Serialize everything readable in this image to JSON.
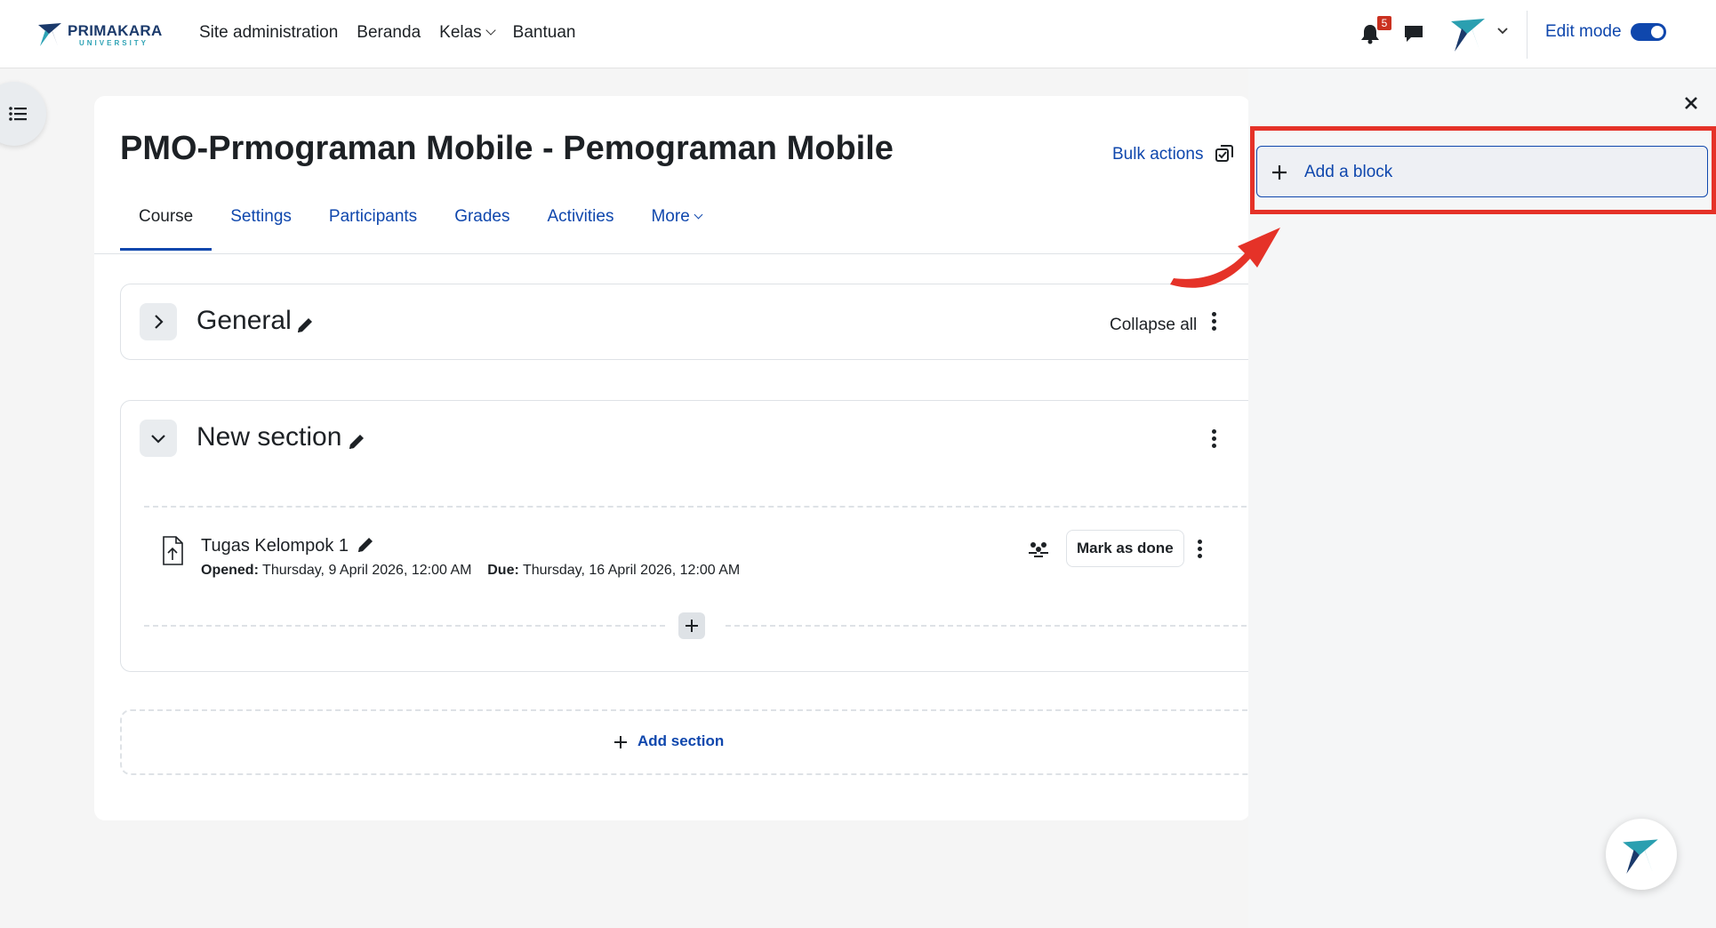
{
  "navbar": {
    "brand_name": "PRIMAKARA",
    "brand_sub": "UNIVERSITY",
    "links": [
      "Site administration",
      "Beranda",
      "Kelas",
      "Bantuan"
    ],
    "notification_count": "5",
    "edit_mode_label": "Edit mode",
    "edit_mode_on": true
  },
  "course": {
    "title": "PMO-Prmograman Mobile - Pemograman Mobile",
    "bulk_actions": "Bulk actions",
    "tabs": [
      "Course",
      "Settings",
      "Participants",
      "Grades",
      "Activities",
      "More"
    ],
    "active_tab": "Course"
  },
  "sections": [
    {
      "title": "General",
      "collapse_all": "Collapse all",
      "expanded": false
    },
    {
      "title": "New section",
      "expanded": true,
      "activities": [
        {
          "name": "Tugas Kelompok 1",
          "opened_label": "Opened:",
          "opened": "Thursday, 9 April 2026, 12:00 AM",
          "due_label": "Due:",
          "due": "Thursday, 16 April 2026, 12:00 AM",
          "mark_done": "Mark as done"
        }
      ]
    }
  ],
  "add_section": "Add section",
  "drawer": {
    "add_block": "Add a block"
  },
  "colors": {
    "accent": "#0f47ad",
    "highlight": "#e53228",
    "badge": "#ca3120",
    "brand_teal": "#2fa3b5"
  }
}
